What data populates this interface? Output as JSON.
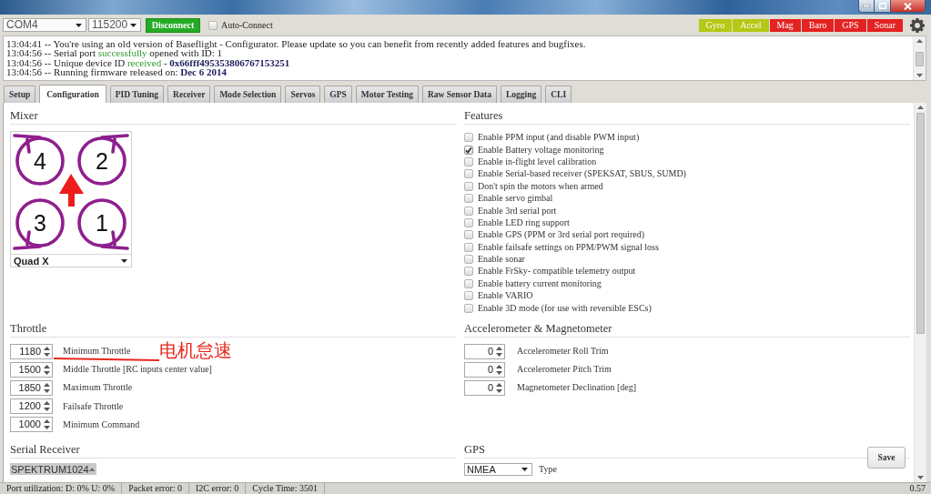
{
  "toolbar": {
    "port": "COM4",
    "baud_rate": "115200",
    "connect_button": "Disconnect",
    "auto_connect": {
      "label": "Auto-Connect",
      "checked": false
    },
    "sensors": [
      {
        "label": "Gyro",
        "color": "#b4c814"
      },
      {
        "label": "Accel",
        "color": "#b4c814"
      },
      {
        "label": "Mag",
        "color": "#e32222"
      },
      {
        "label": "Baro",
        "color": "#e32222"
      },
      {
        "label": "GPS",
        "color": "#e32222"
      },
      {
        "label": "Sonar",
        "color": "#e32222"
      }
    ]
  },
  "log": {
    "lines": [
      {
        "segments": [
          {
            "kind": "plain",
            "text": "13:04:41 -- You're using an old version of Baseflight - Configurator. Please update so you can benefit from recently added features and bugfixes."
          }
        ]
      },
      {
        "segments": [
          {
            "kind": "plain",
            "text": "13:04:56 -- Serial port "
          },
          {
            "kind": "success",
            "text": "successfully"
          },
          {
            "kind": "plain",
            "text": " opened with ID: 1"
          }
        ]
      },
      {
        "segments": [
          {
            "kind": "plain",
            "text": "13:04:56 -- Unique device ID "
          },
          {
            "kind": "success",
            "text": "received"
          },
          {
            "kind": "plain",
            "text": " - "
          },
          {
            "kind": "value",
            "text": "0x66fff495353806767153251"
          }
        ]
      },
      {
        "segments": [
          {
            "kind": "plain",
            "text": "13:04:56 -- Running firmware released on: "
          },
          {
            "kind": "value",
            "text": "Dec 6 2014"
          }
        ]
      }
    ]
  },
  "tabs": [
    {
      "label": "Setup",
      "selected": false
    },
    {
      "label": "Configuration",
      "selected": true
    },
    {
      "label": "PID Tuning",
      "selected": false
    },
    {
      "label": "Receiver",
      "selected": false
    },
    {
      "label": "Mode Selection",
      "selected": false
    },
    {
      "label": "Servos",
      "selected": false
    },
    {
      "label": "GPS",
      "selected": false
    },
    {
      "label": "Motor Testing",
      "selected": false
    },
    {
      "label": "Raw Sensor Data",
      "selected": false
    },
    {
      "label": "Logging",
      "selected": false
    },
    {
      "label": "CLI",
      "selected": false
    }
  ],
  "mixer": {
    "title": "Mixer",
    "motors": [
      "4",
      "2",
      "3",
      "1"
    ],
    "type": "Quad X"
  },
  "features": {
    "title": "Features",
    "items": [
      {
        "label": "Enable PPM input (and disable PWM input)",
        "checked": false
      },
      {
        "label": "Enable Battery voltage monitoring",
        "checked": true
      },
      {
        "label": "Enable in-flight level calibration",
        "checked": false
      },
      {
        "label": "Enable Serial-based receiver (SPEKSAT, SBUS, SUMD)",
        "checked": false
      },
      {
        "label": "Don't spin the motors when armed",
        "checked": false
      },
      {
        "label": "Enable servo gimbal",
        "checked": false
      },
      {
        "label": "Enable 3rd serial port",
        "checked": false
      },
      {
        "label": "Enable LED ring support",
        "checked": false
      },
      {
        "label": "Enable GPS (PPM or 3rd serial port required)",
        "checked": false
      },
      {
        "label": "Enable failsafe settings on PPM/PWM signal loss",
        "checked": false
      },
      {
        "label": "Enable sonar",
        "checked": false
      },
      {
        "label": "Enable FrSky- compatible telemetry output",
        "checked": false
      },
      {
        "label": "Enable battery current monitoring",
        "checked": false
      },
      {
        "label": "Enable VARIO",
        "checked": false
      },
      {
        "label": "Enable 3D mode (for use with reversible ESCs)",
        "checked": false
      }
    ]
  },
  "throttle": {
    "title": "Throttle",
    "rows": [
      {
        "value": "1180",
        "label": "Minimum Throttle"
      },
      {
        "value": "1500",
        "label": "Middle Throttle [RC inputs center value]"
      },
      {
        "value": "1850",
        "label": "Maximum Throttle"
      },
      {
        "value": "1200",
        "label": "Failsafe Throttle"
      },
      {
        "value": "1000",
        "label": "Minimum Command"
      }
    ]
  },
  "annotation": {
    "text": "电机怠速"
  },
  "accelerometer_magnetometer": {
    "title": "Accelerometer & Magnetometer",
    "rows": [
      {
        "value": "0",
        "label": "Accelerometer Roll Trim"
      },
      {
        "value": "0",
        "label": "Accelerometer Pitch Trim"
      },
      {
        "value": "0",
        "label": "Magnetometer Declination [deg]"
      }
    ]
  },
  "serial_receiver": {
    "title": "Serial Receiver",
    "provider": "SPEKTRUM1024"
  },
  "gps": {
    "title": "GPS",
    "protocol": "NMEA",
    "protocol_label": "Type"
  },
  "save_button": "Save",
  "status_bar": {
    "items": [
      "Port utilization: D: 0% U: 0%",
      "Packet error: 0",
      "I2C error: 0",
      "Cycle Time: 3501"
    ],
    "version": "0.57"
  }
}
